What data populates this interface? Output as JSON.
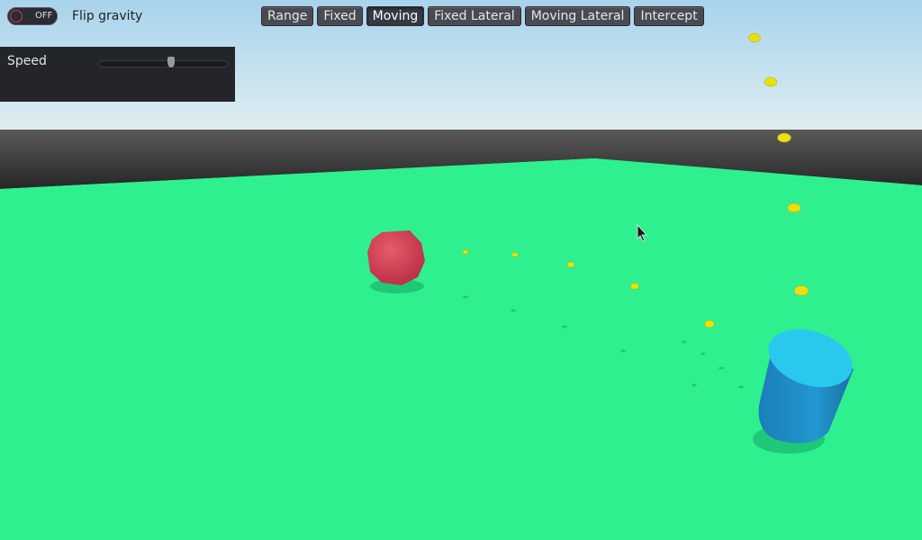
{
  "toggle": {
    "state_text": "OFF",
    "label": "Flip gravity",
    "on": false
  },
  "panel": {
    "speed_label": "Speed",
    "speed_value": 0.57
  },
  "modes": [
    {
      "label": "Range",
      "active": false
    },
    {
      "label": "Fixed",
      "active": false
    },
    {
      "label": "Moving",
      "active": true
    },
    {
      "label": "Fixed Lateral",
      "active": false
    },
    {
      "label": "Moving Lateral",
      "active": false
    },
    {
      "label": "Intercept",
      "active": false
    }
  ],
  "colors": {
    "ground": "#2ff08f",
    "wall": "#3a3a3a",
    "target_sphere": "#d8485c",
    "shooter_cylinder": "#1f9fd8",
    "projectile": "#e8e010"
  }
}
